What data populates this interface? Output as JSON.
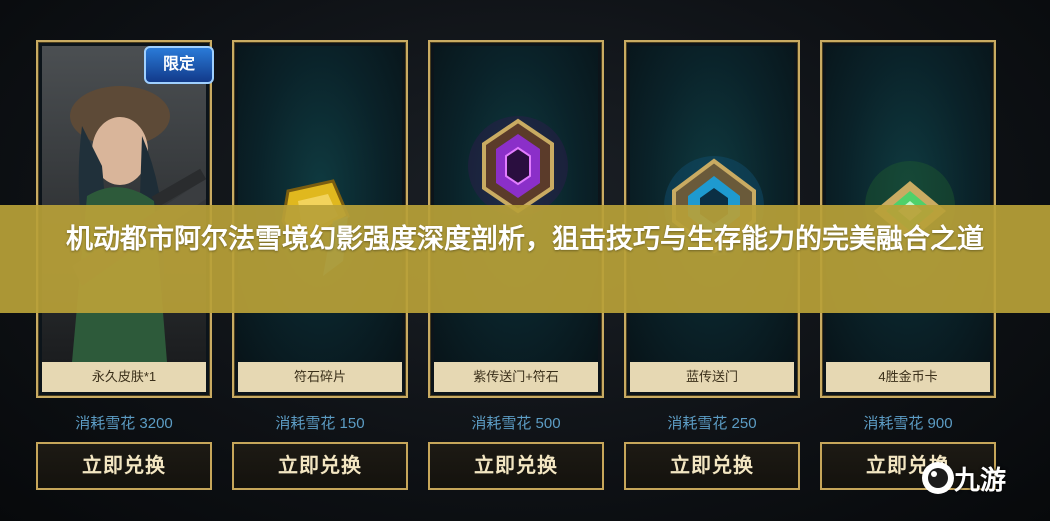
{
  "banner": {
    "title": "机动都市阿尔法雪境幻影强度深度剖析，狙击技巧与生存能力的完美融合之道"
  },
  "badge": {
    "text": "限定"
  },
  "cards": [
    {
      "name": "永久皮肤*1",
      "cost": "消耗雪花 3200",
      "button": "立即兑换"
    },
    {
      "name": "符石碎片",
      "cost": "消耗雪花 150",
      "button": "立即兑换"
    },
    {
      "name": "紫传送门+符石",
      "cost": "消耗雪花 500",
      "button": "立即兑换"
    },
    {
      "name": "蓝传送门",
      "cost": "消耗雪花 250",
      "button": "立即兑换"
    },
    {
      "name": "4胜金币卡",
      "cost": "消耗雪花 900",
      "button": "立即兑换"
    }
  ],
  "watermark": {
    "text": "九游"
  },
  "colors": {
    "gold_border": "#c9ab62",
    "banner": "#b8a038",
    "cost_text": "#5c9cc4",
    "purple_gem": "#8b2fc9",
    "blue_gem": "#1e9ad0",
    "green_gem": "#4fd06a",
    "yellow_gem": "#e0b81e"
  },
  "icons": [
    "skin-portrait-icon",
    "rune-shard-icon",
    "purple-portal-icon",
    "blue-portal-icon",
    "gold-card-icon",
    "nine-game-logo-icon"
  ]
}
